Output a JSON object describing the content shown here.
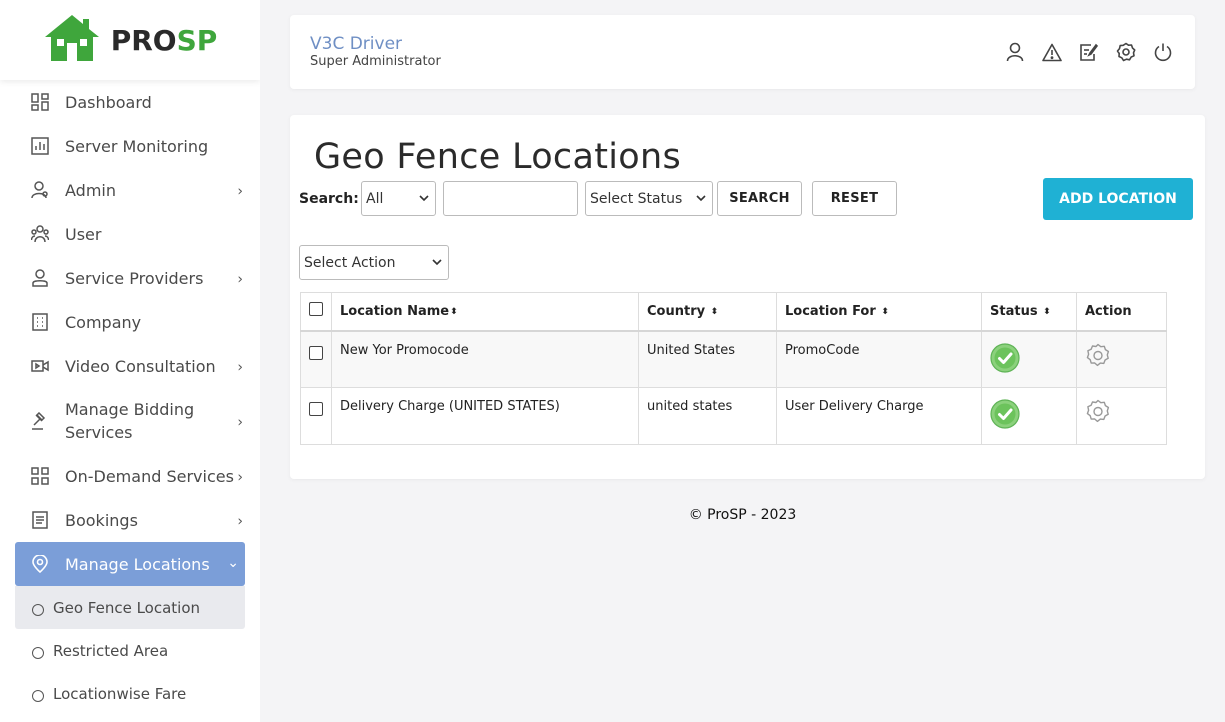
{
  "brand": {
    "pro": "PRO",
    "sp": "SP"
  },
  "sidebar": {
    "items": [
      {
        "label": "Dashboard",
        "icon": "dashboard-icon",
        "chevron": false
      },
      {
        "label": "Server Monitoring",
        "icon": "chart-icon",
        "chevron": false
      },
      {
        "label": "Admin",
        "icon": "admin-user-icon",
        "chevron": true
      },
      {
        "label": "User",
        "icon": "users-icon",
        "chevron": false
      },
      {
        "label": "Service Providers",
        "icon": "provider-icon",
        "chevron": true
      },
      {
        "label": "Company",
        "icon": "building-icon",
        "chevron": false
      },
      {
        "label": "Video Consultation",
        "icon": "video-icon",
        "chevron": true
      },
      {
        "label": "Manage Bidding Services",
        "icon": "gavel-icon",
        "chevron": true
      },
      {
        "label": "On-Demand Services",
        "icon": "grid-icon",
        "chevron": true
      },
      {
        "label": "Bookings",
        "icon": "document-icon",
        "chevron": true
      },
      {
        "label": "Manage Locations",
        "icon": "location-pin-icon",
        "chevron": true,
        "active": true
      }
    ],
    "sub_items": [
      {
        "label": "Geo Fence Location",
        "current": true
      },
      {
        "label": "Restricted Area"
      },
      {
        "label": "Locationwise Fare"
      }
    ]
  },
  "header": {
    "name": "V3C Driver",
    "role": "Super Administrator",
    "icons": [
      "profile-icon",
      "alert-icon",
      "edit-icon",
      "settings-icon",
      "power-icon"
    ]
  },
  "main": {
    "title": "Geo Fence Locations",
    "search_label": "Search:",
    "search_option": "All",
    "status_option": "Select Status",
    "search_button": "SEARCH",
    "reset_button": "RESET",
    "add_button": "ADD LOCATION",
    "action_option": "Select Action",
    "table": {
      "headers": [
        "Location Name",
        "Country",
        "Location For",
        "Status",
        "Action"
      ],
      "rows": [
        {
          "name": "New Yor Promocode",
          "country": "United States",
          "for": "PromoCode",
          "status": "active"
        },
        {
          "name": "Delivery Charge (UNITED STATES)",
          "country": "united states",
          "for": "User Delivery Charge",
          "status": "active"
        }
      ]
    }
  },
  "footer": {
    "text": "© ProSP - 2023"
  },
  "colors": {
    "accent": "#1fb1d4",
    "active_nav": "#7b9ed8",
    "brand_green": "#3fa63c",
    "status_green": "#8bd17c"
  }
}
